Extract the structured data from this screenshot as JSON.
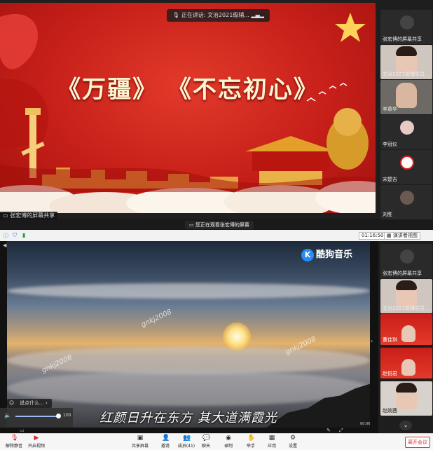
{
  "top_meeting": {
    "speaker_status": "正在讲话: 文治2021级辅...",
    "slide_title": "《万疆》  《不忘初心》",
    "share_label": "张宏博的屏幕共享",
    "participants": [
      {
        "name": "张宏博的屏幕共享",
        "kind": "avatar"
      },
      {
        "name": "文治2021级辅导员...",
        "kind": "video"
      },
      {
        "name": "辛章华",
        "kind": "video"
      },
      {
        "name": "李冠仪",
        "kind": "avatar"
      },
      {
        "name": "宋楚吉",
        "kind": "avatar"
      },
      {
        "name": "刘胜",
        "kind": "avatar"
      }
    ]
  },
  "mid": {
    "notice": "您正在观看张宏博的屏幕",
    "timer": "01:16:50",
    "view_mode": "演讲者视图"
  },
  "video": {
    "app_name": "酷狗音乐",
    "app_logo_letter": "K",
    "lyrics": "红颜日升在东方  其大道满霞光",
    "watermark": "gnkj2008",
    "comment_placeholder": "说点什么...",
    "volume": 100,
    "volume_label": "100",
    "time_readout": "00:06"
  },
  "lower_participants": [
    {
      "name": "张宏博的屏幕共享",
      "kind": "avatar"
    },
    {
      "name": "文治2021级辅导员...",
      "kind": "video"
    },
    {
      "name": "曹佳琪",
      "kind": "slide"
    },
    {
      "name": "赵悦君",
      "kind": "slide"
    },
    {
      "name": "赵婉茜",
      "kind": "video"
    }
  ],
  "toolbar": [
    {
      "id": "mute",
      "label": "解除静音",
      "icon": "microphone-muted-icon"
    },
    {
      "id": "video",
      "label": "开启视频",
      "icon": "camera-off-icon"
    },
    {
      "id": "share",
      "label": "共享屏幕",
      "icon": "screen-share-icon"
    },
    {
      "id": "invite",
      "label": "邀请",
      "icon": "person-add-icon"
    },
    {
      "id": "members",
      "label": "成员(41)",
      "icon": "people-icon"
    },
    {
      "id": "chat",
      "label": "聊天",
      "icon": "chat-icon"
    },
    {
      "id": "record",
      "label": "录制",
      "icon": "record-icon"
    },
    {
      "id": "hand",
      "label": "举手",
      "icon": "hand-icon"
    },
    {
      "id": "apps",
      "label": "应用",
      "icon": "apps-icon"
    },
    {
      "id": "settings",
      "label": "设置",
      "icon": "gear-icon"
    }
  ],
  "leave_label": "离开会议",
  "colors": {
    "slide_red": "#c61f19",
    "accent_blue": "#2a6ad0",
    "leave_red": "#d33333"
  }
}
